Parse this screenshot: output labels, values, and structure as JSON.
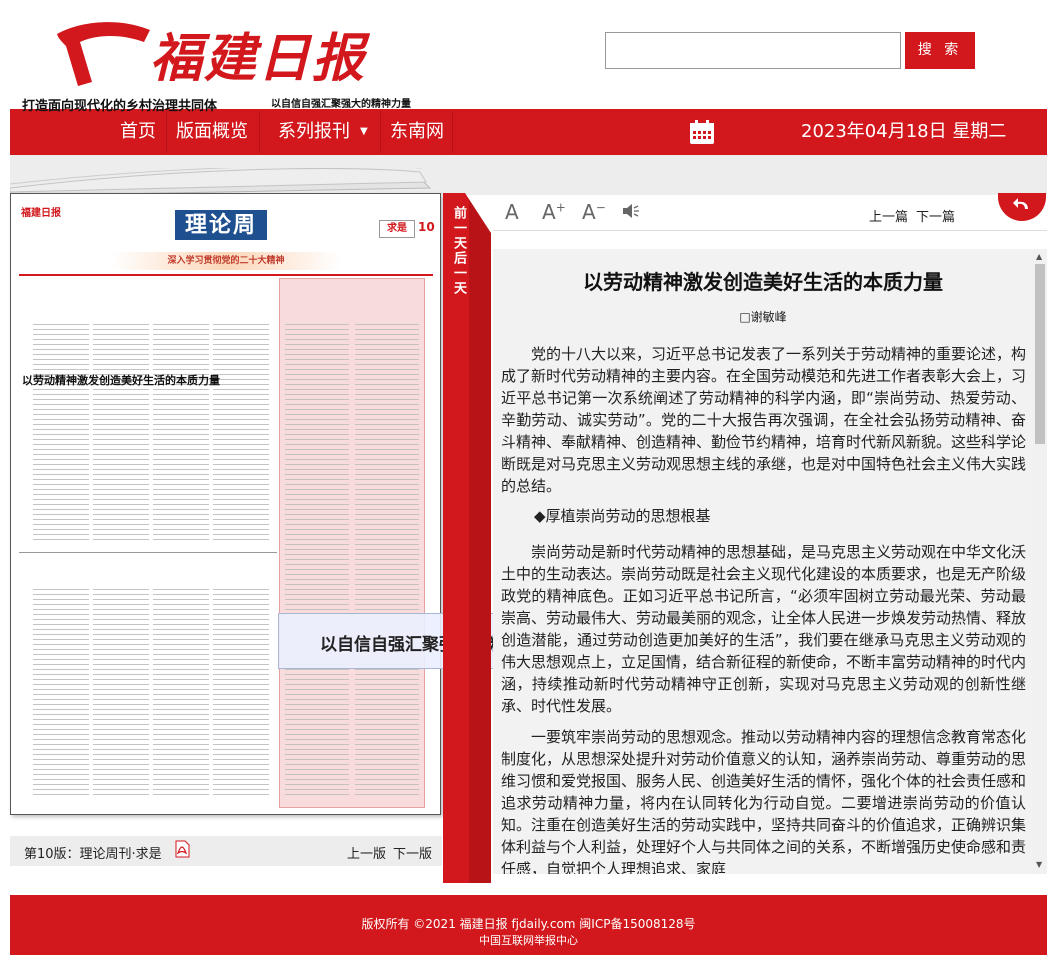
{
  "brand": {
    "logo_text": "福建日报",
    "accent_color": "#d2181c"
  },
  "search": {
    "placeholder": "",
    "button_label": "搜 索"
  },
  "nav": {
    "items": [
      {
        "label": "首页"
      },
      {
        "label": "版面概览"
      },
      {
        "label": "系列报刊"
      },
      {
        "label": "东南网"
      }
    ],
    "dropdown_caret": "▼",
    "date": "2023年04月18日 星期二"
  },
  "ribbon": {
    "label": "前一天后一天"
  },
  "paper": {
    "masthead_logo": "福建日报",
    "section": "理论周刊",
    "qiushi": "求是",
    "page_number": "10",
    "banner": "深入学习贯彻党的二十大精神",
    "headlines": [
      "打造面向现代化的乡村治理共同体",
      "以自信自强汇聚强大的精神力量",
      "以劳动精神激发创造美好生活的本质力量"
    ],
    "hover_title": "以自信自强汇聚强大的精神力量",
    "footer_label": "第10版：理论周刊·求是",
    "prev": "上一版",
    "next": "下一版"
  },
  "toolbar": {
    "font_reset": "A",
    "font_increase": "A",
    "font_increase_sup": "+",
    "font_decrease": "A",
    "font_decrease_sup": "−",
    "prev_article": "上一篇",
    "next_article": "下一篇"
  },
  "article": {
    "title": "以劳动精神激发创造美好生活的本质力量",
    "author": "□谢敏峰",
    "paragraphs": [
      "党的十八大以来，习近平总书记发表了一系列关于劳动精神的重要论述，构成了新时代劳动精神的主要内容。在全国劳动模范和先进工作者表彰大会上，习近平总书记第一次系统阐述了劳动精神的科学内涵，即“崇尚劳动、热爱劳动、辛勤劳动、诚实劳动”。党的二十大报告再次强调，在全社会弘扬劳动精神、奋斗精神、奉献精神、创造精神、勤俭节约精神，培育时代新风新貌。这些科学论断既是对马克思主义劳动观思想主线的承继，也是对中国特色社会主义伟大实践的总结。",
      "崇尚劳动是新时代劳动精神的思想基础，是马克思主义劳动观在中华文化沃土中的生动表达。崇尚劳动既是社会主义现代化建设的本质要求，也是无产阶级政党的精神底色。正如习近平总书记所言，“必须牢固树立劳动最光荣、劳动最崇高、劳动最伟大、劳动最美丽的观念，让全体人民进一步焕发劳动热情、释放创造潜能，通过劳动创造更加美好的生活”，我们要在继承马克思主义劳动观的伟大思想观点上，立足国情，结合新征程的新使命，不断丰富劳动精神的时代内涵，持续推动新时代劳动精神守正创新，实现对马克思主义劳动观的创新性继承、时代性发展。",
      "一要筑牢崇尚劳动的思想观念。推动以劳动精神内容的理想信念教育常态化制度化，从思想深处提升对劳动价值意义的认知，涵养崇尚劳动、尊重劳动的思维习惯和爱党报国、服务人民、创造美好生活的情怀，强化个体的社会责任感和追求劳动精神力量，将内在认同转化为行动自觉。二要增进崇尚劳动的价值认知。注重在创造美好生活的劳动实践中，坚持共同奋斗的价值追求，正确辨识集体利益与个人利益，处理好个人与共同体之间的关系，不断增强历史使命感和责任感，自觉把个人理想追求、家庭"
    ],
    "subhead": "◆厚植崇尚劳动的思想根基"
  },
  "footer": {
    "copyright": "版权所有 ©2021 福建日报 fjdaily.com 闽ICP备15008128号",
    "report_center": "中国互联网举报中心"
  }
}
